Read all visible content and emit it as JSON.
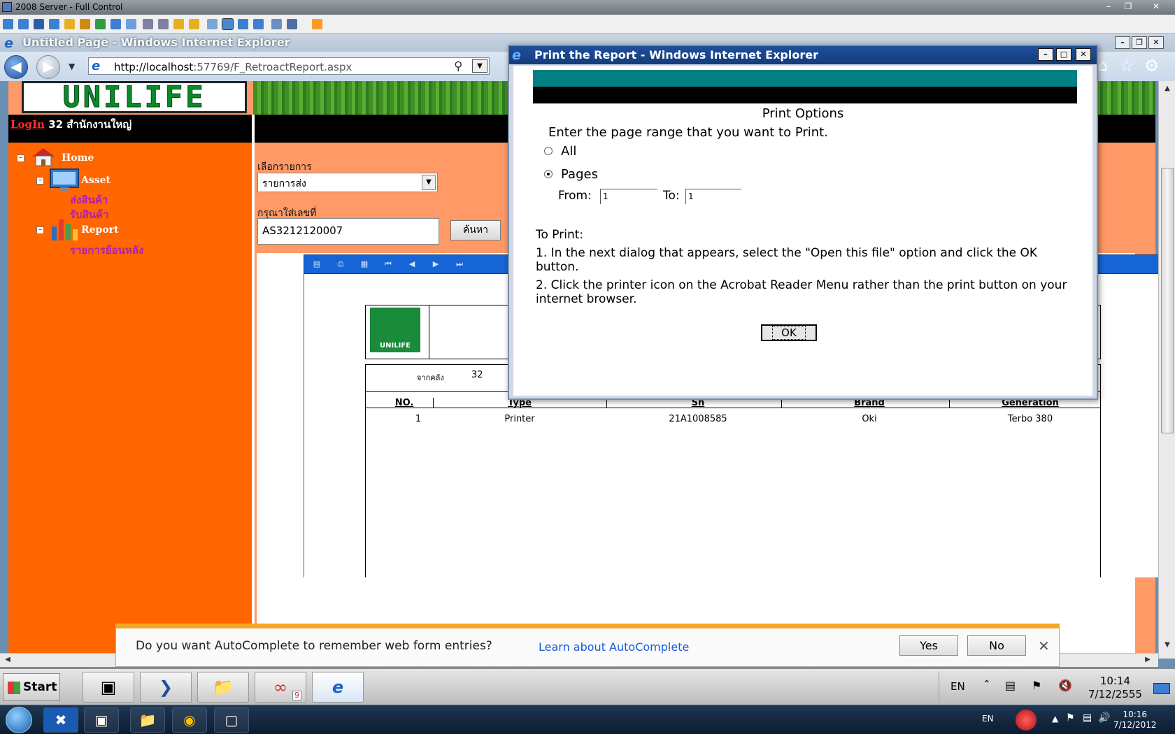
{
  "remote": {
    "title": "2008 Server - Full Control"
  },
  "ie": {
    "title": "Untitled Page - Windows Internet Explorer",
    "url_host": "http://localhost",
    "url_rest": ":57769/F_RetroactReport.aspx"
  },
  "site": {
    "logo_text": "UNILIFE",
    "login_link": "LogIn",
    "login_office": "32 สำนักงานใหญ่"
  },
  "sidebar": {
    "home": "Home",
    "asset": "Asset",
    "asset_items": [
      "ส่งสินค้า",
      "รับสินค้า"
    ],
    "report": "Report",
    "report_items": [
      "รายการย้อนหลัง"
    ]
  },
  "form": {
    "select_label": "เลือกรายการ",
    "select_value": "รายการส่ง",
    "number_label": "กรุณาใส่เลขที่",
    "number_value": "AS3212120007",
    "search_button": "ค้นหา"
  },
  "report": {
    "from_label": "จากคลัง",
    "from_value": "32",
    "columns": [
      "NO.",
      "Type",
      "Sn",
      "Brand",
      "Generation"
    ],
    "rows": [
      {
        "no": "1",
        "type": "Printer",
        "sn": "21A1008585",
        "brand": "Oki",
        "generation": "Terbo 380"
      }
    ]
  },
  "dialog": {
    "title": "Print the Report - Windows Internet Explorer",
    "heading": "Print Options",
    "instruction": "Enter the page range that you want to Print.",
    "option_all": "All",
    "option_pages": "Pages",
    "selected_option": "Pages",
    "from_label": "From:",
    "from_value": "1",
    "to_label": "To:",
    "to_value": "1",
    "to_print_label": "To Print:",
    "step1": "1. In the next dialog that appears, select the \"Open this file\" option and click the OK button.",
    "step2": "2. Click the printer icon on the Acrobat Reader Menu rather than the print button on your internet browser.",
    "ok_button": "OK"
  },
  "autocomplete": {
    "message": "Do you want AutoComplete to remember web form entries?",
    "learn_link": "Learn about AutoComplete",
    "yes": "Yes",
    "no": "No"
  },
  "remote_taskbar": {
    "start": "Start",
    "lang": "EN",
    "time": "10:14",
    "date": "7/12/2555",
    "badge": "9"
  },
  "host_taskbar": {
    "lang": "EN",
    "time": "10:16",
    "date": "7/12/2012"
  }
}
